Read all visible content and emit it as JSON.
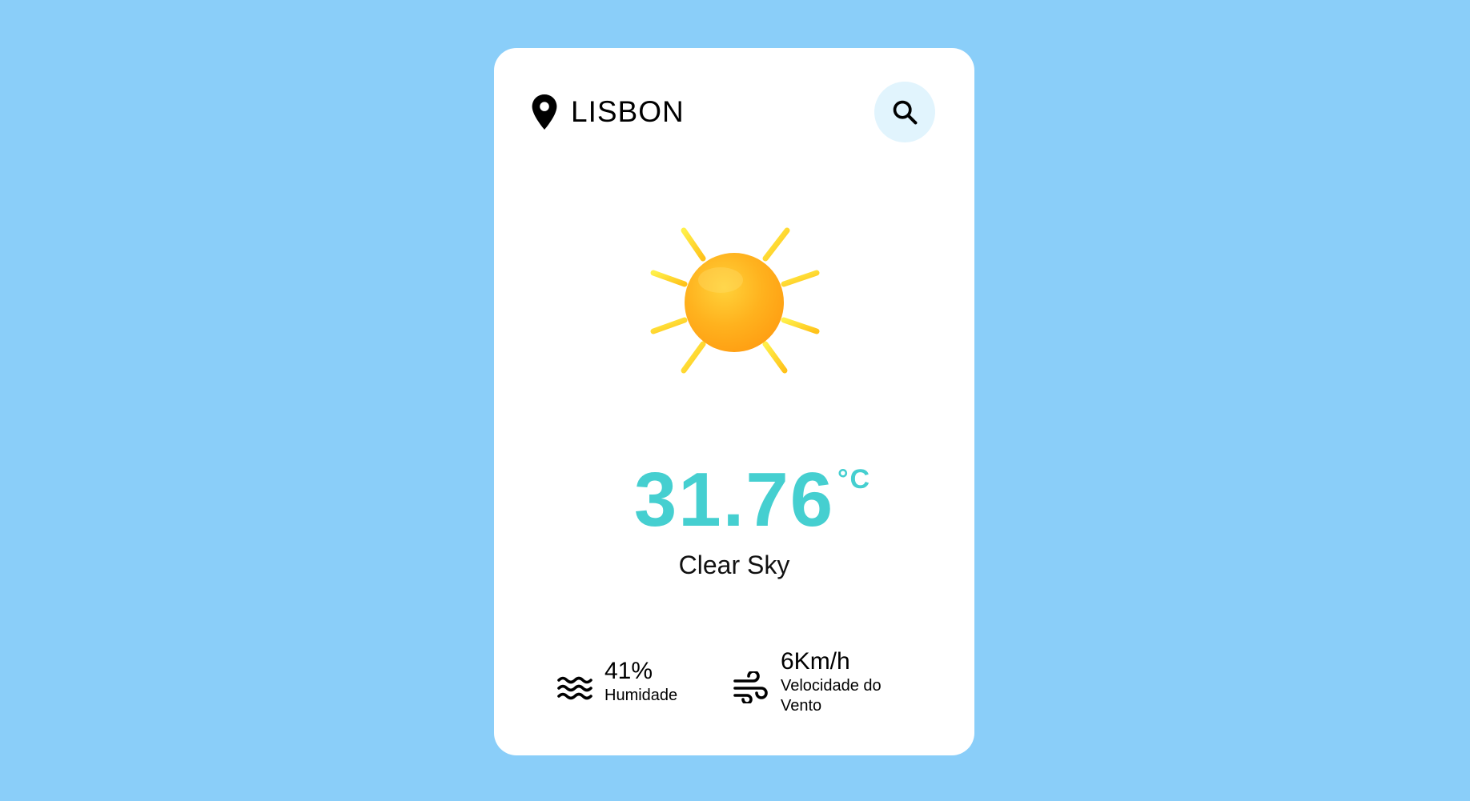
{
  "location": {
    "city": "LISBON",
    "icon": "map-pin-icon"
  },
  "search": {
    "icon": "search-icon"
  },
  "weather": {
    "icon": "sun-icon",
    "temperature": "31.76",
    "unit": "°C",
    "description": "Clear Sky"
  },
  "humidity": {
    "icon": "water-waves-icon",
    "value": "41%",
    "label": "Humidade"
  },
  "wind": {
    "icon": "wind-icon",
    "value": "6Km/h",
    "label": "Velocidade do Vento"
  },
  "colors": {
    "background": "#8ACEF9",
    "card": "#FFFFFF",
    "accent": "#45CFD0",
    "search_button_bg": "#E1F4FD",
    "sun": "#FFB020"
  }
}
